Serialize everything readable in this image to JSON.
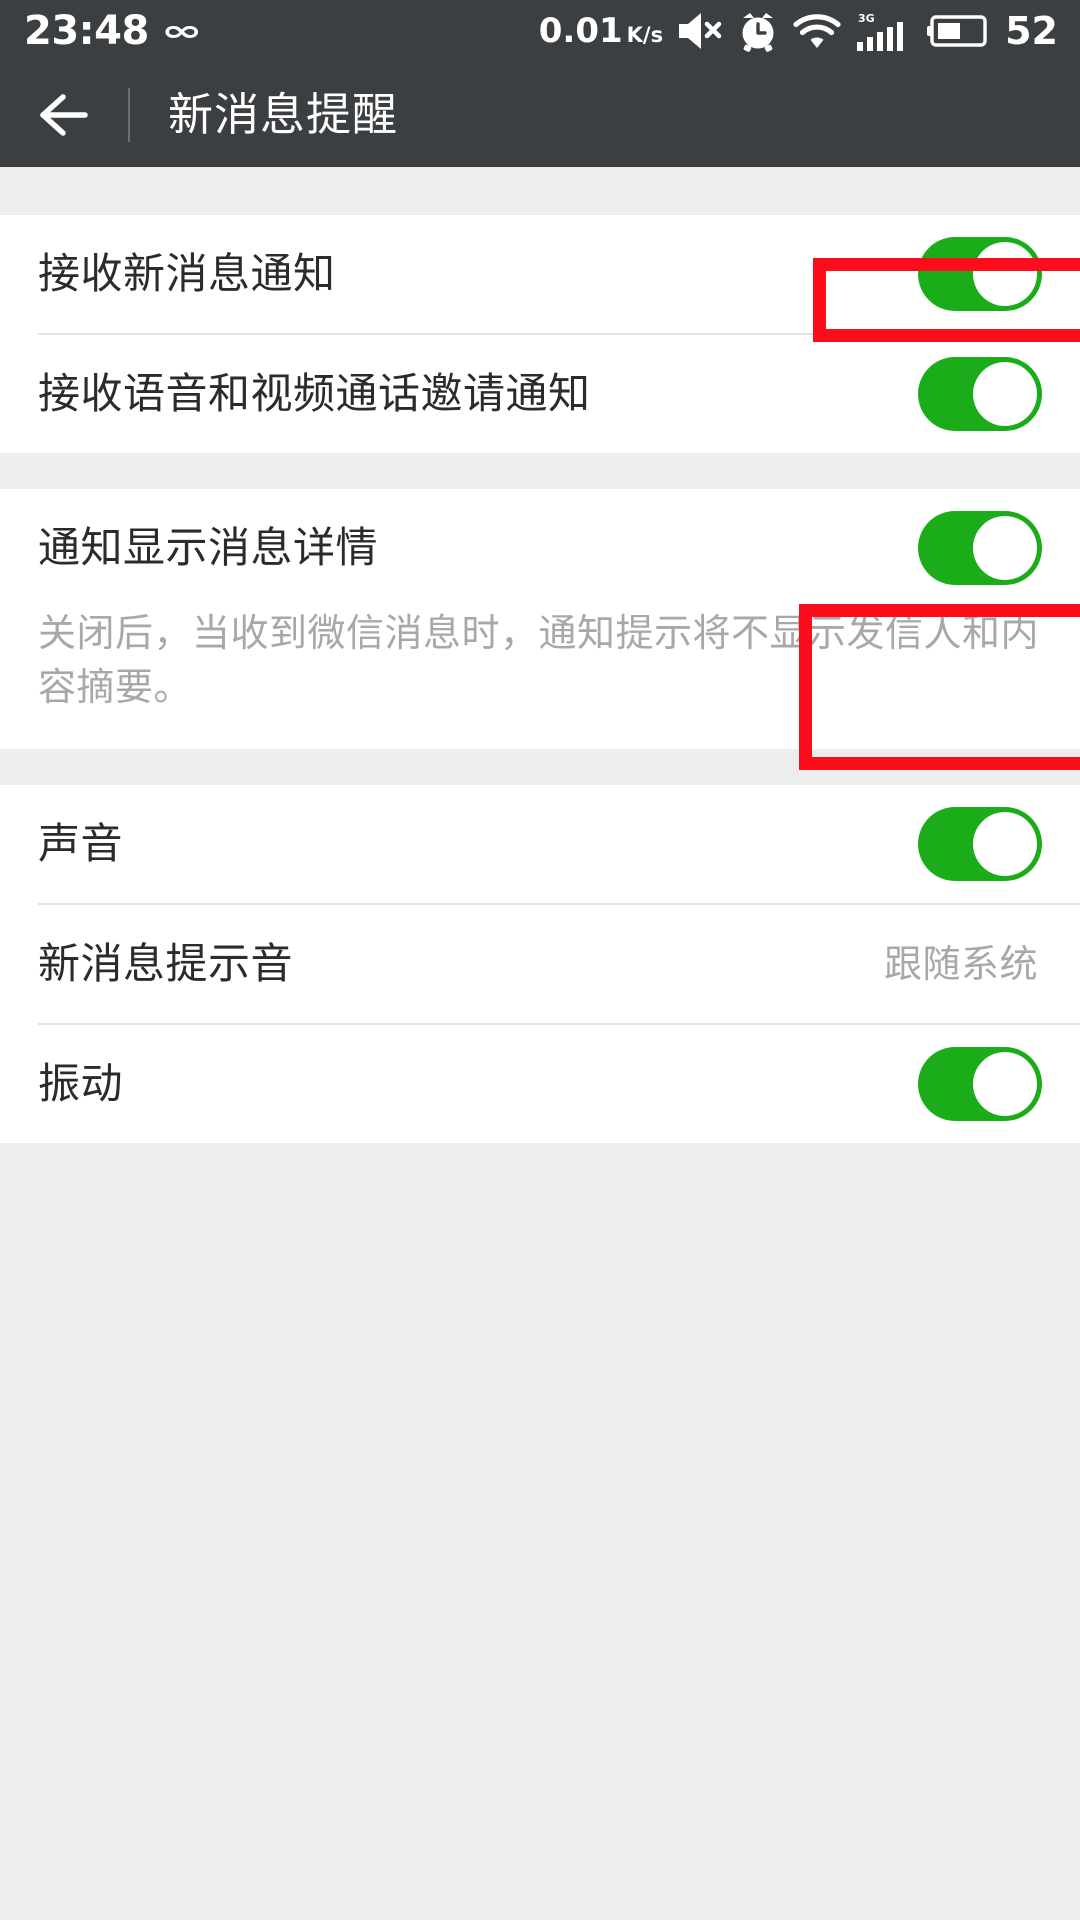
{
  "status_bar": {
    "time": "23:48",
    "infinity_icon": "infinity-icon",
    "network_speed": "0.01",
    "network_speed_unit": "K/s",
    "mute_icon": "speaker-mute-icon",
    "alarm_icon": "alarm-clock-icon",
    "wifi_icon": "wifi-icon",
    "signal_icon": "signal-bars-3g-icon",
    "signal_label": "3G",
    "battery_icon": "battery-icon",
    "battery_level": "52"
  },
  "header": {
    "back_icon": "back-arrow-icon",
    "title": "新消息提醒"
  },
  "groups": [
    {
      "rows": [
        {
          "label": "接收新消息通知",
          "type": "toggle",
          "state": "on",
          "highlighted": true
        },
        {
          "label": "接收语音和视频通话邀请通知",
          "type": "toggle",
          "state": "on",
          "highlighted": false
        }
      ]
    },
    {
      "rows": [
        {
          "label": "通知显示消息详情",
          "type": "toggle",
          "state": "on",
          "highlighted": true
        }
      ],
      "description": "关闭后，当收到微信消息时，通知提示将不显示发信人和内容摘要。"
    },
    {
      "rows": [
        {
          "label": "声音",
          "type": "toggle",
          "state": "on",
          "highlighted": false
        },
        {
          "label": "新消息提示音",
          "type": "value",
          "value": "跟随系统",
          "highlighted": false
        },
        {
          "label": "振动",
          "type": "toggle",
          "state": "on",
          "highlighted": false
        }
      ]
    }
  ],
  "colors": {
    "header_bg": "#3c3f41",
    "page_bg": "#ededed",
    "row_bg": "#ffffff",
    "toggle_on": "#1aad19",
    "annotation_red": "#fc0d1b",
    "label_text": "#2b2b2b",
    "secondary_text": "#a8a8a8"
  }
}
